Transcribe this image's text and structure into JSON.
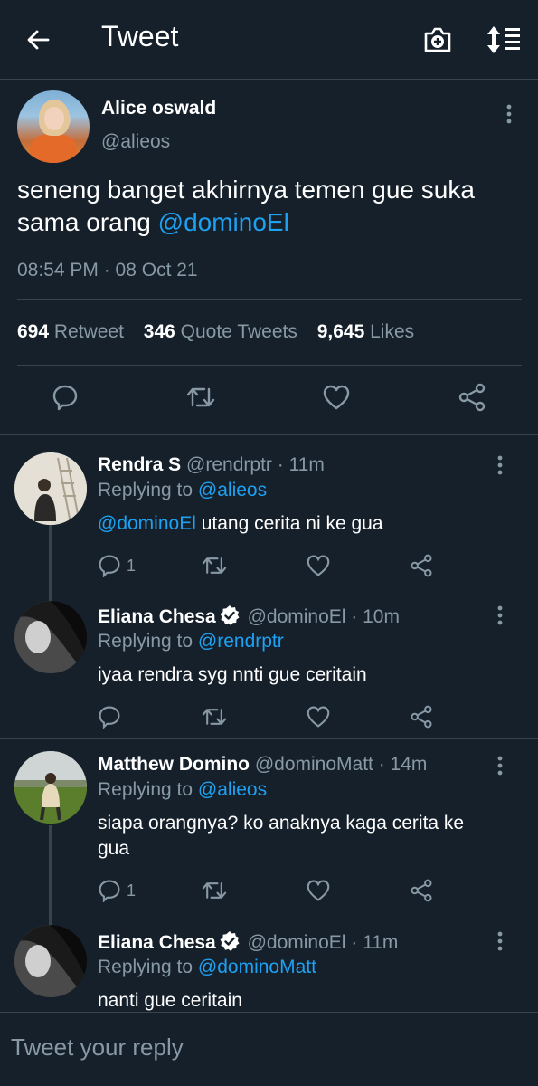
{
  "header": {
    "title": "Tweet",
    "back_icon": "arrow-left-icon",
    "camera_icon": "camera-plus-icon",
    "sort_icon": "sort-icon"
  },
  "main_tweet": {
    "name": "Alice oswald",
    "handle": "@alieos",
    "text_plain": "seneng banget akhirnya temen gue suka sama orang",
    "text_mention": "@dominoEl",
    "timestamp": "08:54 PM · 08 Oct 21",
    "stats": {
      "retweets": "694",
      "retweets_label": "Retweet",
      "quotes": "346",
      "quotes_label": "Quote Tweets",
      "likes": "9,645",
      "likes_label": "Likes"
    }
  },
  "replies": [
    {
      "name": "Rendra S",
      "handle": "@rendrptr",
      "time": "· 11m",
      "replying_label": "Replying to",
      "replying_to": "@alieos",
      "mention": "@dominoEl",
      "text": "utang cerita ni ke gua",
      "reply_count": "1",
      "verified": false
    },
    {
      "name": "Eliana Chesa",
      "handle": "@dominoEl",
      "time": "· 10m",
      "replying_label": "Replying to",
      "replying_to": "@rendrptr",
      "text": "iyaa rendra syg nnti gue ceritain",
      "reply_count": "",
      "verified": true
    },
    {
      "name": "Matthew Domino",
      "handle": "@dominoMatt",
      "time": "· 14m",
      "replying_label": "Replying to",
      "replying_to": "@alieos",
      "text": "siapa orangnya? ko anaknya kaga cerita ke gua",
      "reply_count": "1",
      "verified": false
    },
    {
      "name": "Eliana Chesa",
      "handle": "@dominoEl",
      "time": "· 11m",
      "replying_label": "Replying to",
      "replying_to": "@dominoMatt",
      "text": "nanti gue ceritain",
      "verified": true
    }
  ],
  "reply_bar": {
    "placeholder": "Tweet your reply"
  },
  "colors": {
    "background": "#15202b",
    "link": "#1da1f2",
    "muted": "#8899a6",
    "divider": "#38444d"
  }
}
